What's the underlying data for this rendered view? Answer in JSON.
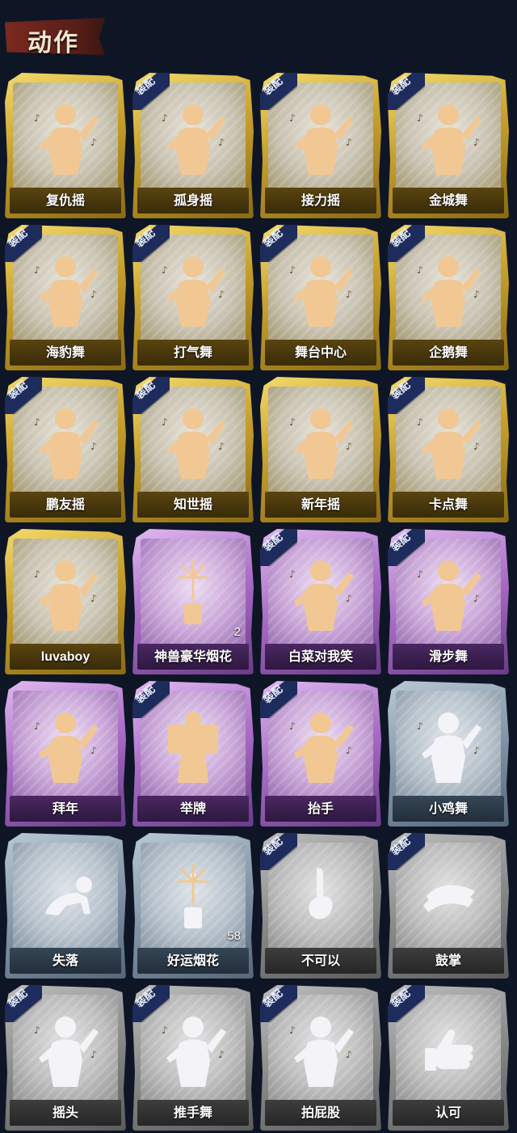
{
  "header": {
    "title": "动作"
  },
  "equip_label": "装配",
  "cards": [
    {
      "name": "复仇摇",
      "tier": "gold",
      "equipped": false,
      "count": "",
      "icon": "dance-pose-icon"
    },
    {
      "name": "孤身摇",
      "tier": "gold",
      "equipped": true,
      "count": "",
      "icon": "dance-pose-icon"
    },
    {
      "name": "接力摇",
      "tier": "gold",
      "equipped": true,
      "count": "",
      "icon": "dance-pose-icon"
    },
    {
      "name": "金城舞",
      "tier": "gold",
      "equipped": true,
      "count": "",
      "icon": "dance-pose-icon"
    },
    {
      "name": "海豹舞",
      "tier": "gold",
      "equipped": true,
      "count": "",
      "icon": "dance-pose-icon"
    },
    {
      "name": "打气舞",
      "tier": "gold",
      "equipped": true,
      "count": "",
      "icon": "dance-pose-icon"
    },
    {
      "name": "舞台中心",
      "tier": "gold",
      "equipped": true,
      "count": "",
      "icon": "dance-pose-icon"
    },
    {
      "name": "企鹅舞",
      "tier": "gold",
      "equipped": true,
      "count": "",
      "icon": "dance-pose-icon"
    },
    {
      "name": "鹏友摇",
      "tier": "gold",
      "equipped": true,
      "count": "",
      "icon": "dance-pose-icon"
    },
    {
      "name": "知世摇",
      "tier": "gold",
      "equipped": true,
      "count": "",
      "icon": "dance-pose-icon"
    },
    {
      "name": "新年摇",
      "tier": "gold",
      "equipped": false,
      "count": "",
      "icon": "dance-pose-icon"
    },
    {
      "name": "卡点舞",
      "tier": "gold",
      "equipped": true,
      "count": "",
      "icon": "dance-pose-icon"
    },
    {
      "name": "luvaboy",
      "tier": "gold",
      "equipped": false,
      "count": "",
      "icon": "dance-pose-icon"
    },
    {
      "name": "神兽豪华烟花",
      "tier": "purple",
      "equipped": false,
      "count": "2",
      "icon": "firework-icon"
    },
    {
      "name": "白菜对我笑",
      "tier": "purple",
      "equipped": true,
      "count": "",
      "icon": "dance-pose-icon"
    },
    {
      "name": "滑步舞",
      "tier": "purple",
      "equipped": true,
      "count": "",
      "icon": "dance-pose-icon"
    },
    {
      "name": "拜年",
      "tier": "purple",
      "equipped": false,
      "count": "",
      "icon": "bow-pose-icon"
    },
    {
      "name": "举牌",
      "tier": "purple",
      "equipped": true,
      "count": "",
      "icon": "sign-hold-icon"
    },
    {
      "name": "抬手",
      "tier": "purple",
      "equipped": true,
      "count": "",
      "icon": "raise-hand-icon"
    },
    {
      "name": "小鸡舞",
      "tier": "blue",
      "equipped": false,
      "count": "",
      "icon": "dance-pose-icon"
    },
    {
      "name": "失落",
      "tier": "blue",
      "equipped": false,
      "count": "",
      "icon": "crawl-pose-icon"
    },
    {
      "name": "好运烟花",
      "tier": "blue",
      "equipped": false,
      "count": "58",
      "icon": "firework-icon"
    },
    {
      "name": "不可以",
      "tier": "gray",
      "equipped": true,
      "count": "",
      "icon": "finger-wag-icon"
    },
    {
      "name": "鼓掌",
      "tier": "gray",
      "equipped": true,
      "count": "",
      "icon": "clap-icon"
    },
    {
      "name": "摇头",
      "tier": "gray",
      "equipped": true,
      "count": "",
      "icon": "shake-head-icon"
    },
    {
      "name": "推手舞",
      "tier": "gray",
      "equipped": true,
      "count": "",
      "icon": "push-dance-icon"
    },
    {
      "name": "拍屁股",
      "tier": "gray",
      "equipped": true,
      "count": "",
      "icon": "slap-pose-icon"
    },
    {
      "name": "认可",
      "tier": "gray",
      "equipped": true,
      "count": "",
      "icon": "thumbs-up-icon"
    }
  ]
}
